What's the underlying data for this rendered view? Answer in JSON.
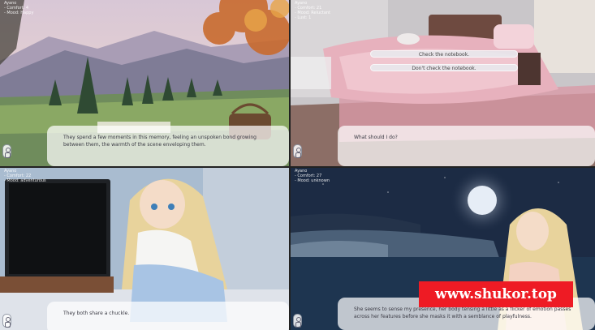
{
  "panels": [
    {
      "stats": [
        "Ayano",
        "- Comfort: 4",
        "- Mood: Happy"
      ],
      "dialogue": "They spend a few moments in this memory, feeling an unspoken bond growing between them, the warmth of the scene enveloping them."
    },
    {
      "stats": [
        "Ayano",
        "- Comfort: 21",
        "- Mood: Reluctant",
        "- Lust: 1"
      ],
      "dialogue": "What should I do?",
      "choices": [
        "Check the notebook.",
        "Don't check the notebook."
      ]
    },
    {
      "stats": [
        "Ayano",
        "- Comfort: 22",
        "- Mood: adventurous"
      ],
      "dialogue": "They both share a chuckle."
    },
    {
      "stats": [
        "Ayano",
        "- Comfort: 27",
        "- Mood: unknown"
      ],
      "dialogue": "She seems to sense my presence, her body tensing a little as a flicker of emotion passes across her features before she masks it with a semblance of playfulness."
    }
  ],
  "watermark": "www.shukor.top",
  "colors": {
    "watermark_bg": "#ee1b24",
    "dialogue_bg": "rgba(255,255,255,0.72)"
  }
}
